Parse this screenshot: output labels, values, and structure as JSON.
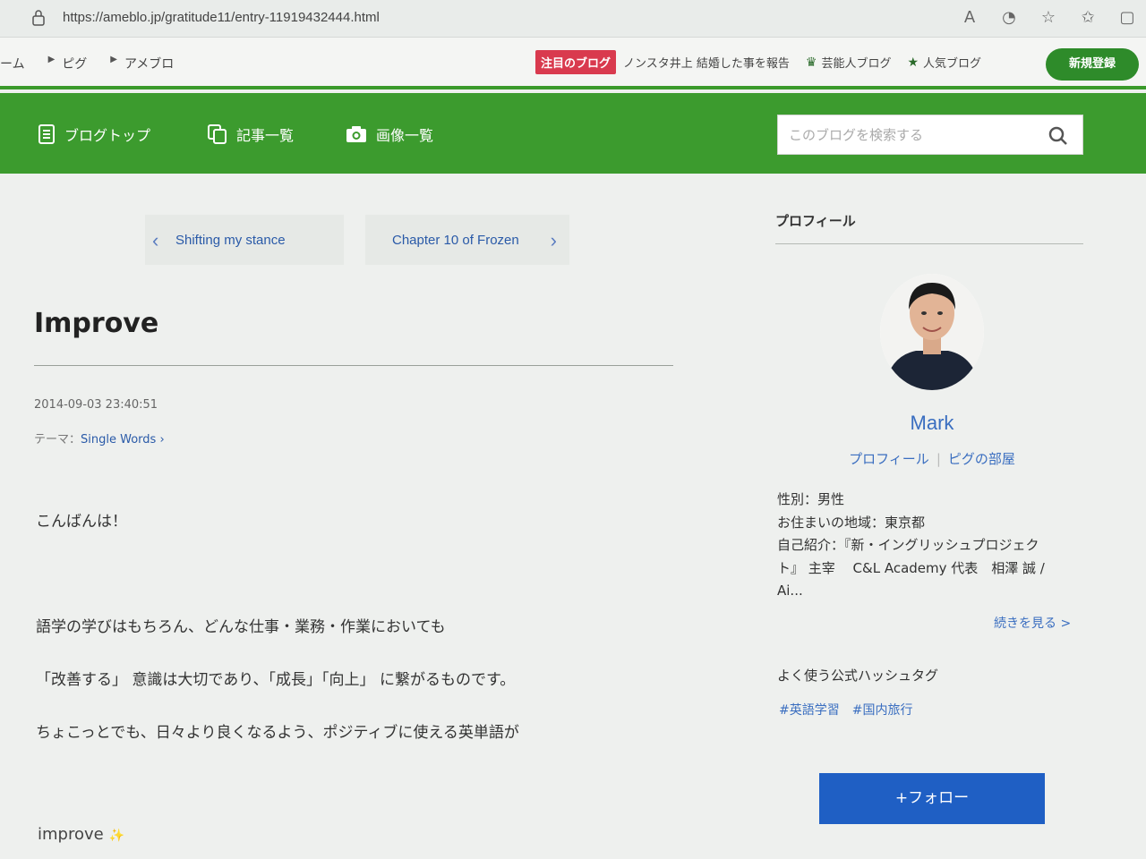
{
  "browser": {
    "url": "https://ameblo.jp/gratitude11/entry-11919432444.html"
  },
  "topbar": {
    "crumbs": [
      "ーム",
      "ピグ",
      "アメブロ"
    ],
    "notice_tag": "注目のブログ",
    "notice_text": "ノンスタ井上 結婚した事を報告",
    "celebrity_blog": "芸能人ブログ",
    "popular_blog": "人気ブログ",
    "signup": "新規登録"
  },
  "nav": {
    "blog_top": "ブログトップ",
    "articles": "記事一覧",
    "images": "画像一覧",
    "search_placeholder": "このブログを検索する"
  },
  "pager": {
    "prev": "Shifting my stance",
    "next": "Chapter 10 of Frozen"
  },
  "entry": {
    "title": "Improve",
    "date": "2014-09-03 23:40:51",
    "theme_label": "テーマ：",
    "theme": "Single Words",
    "p1": "こんばんは！",
    "p2": "語学の学びはもちろん、どんな仕事・業務・作業においても",
    "p3": "「改善する」 意識は大切であり、「成長」「向上」 に繋がるものです。",
    "p4": "ちょこっとでも、日々より良くなるよう、ポジティブに使える英単語が",
    "p5": "improve"
  },
  "sidebar": {
    "heading": "プロフィール",
    "name": "Mark",
    "profile_link": "プロフィール",
    "pigg_link": "ピグの部屋",
    "gender": "性別：男性",
    "area": "お住まいの地域：東京都",
    "intro1": "自己紹介：『新・イングリッシュプロジェク",
    "intro2": "ト』 主宰　 C&L Academy 代表　相澤 誠 /",
    "intro3": "Ai...",
    "more": "続きを見る >",
    "hashtag_heading": "よく使う公式ハッシュタグ",
    "hashtags": [
      "#英語学習",
      "#国内旅行"
    ],
    "follow": "+フォロー"
  }
}
